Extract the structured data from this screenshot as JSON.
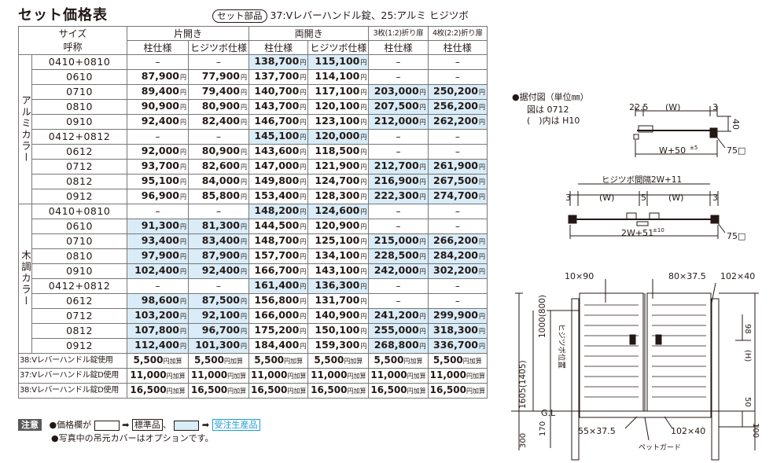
{
  "title": "セット価格表",
  "subtitle": {
    "badge": "セット部品",
    "text": "37:Vレバーハンドル錠、25:アルミ ヒジツボ"
  },
  "table": {
    "size_header": [
      "サイズ",
      "呼称"
    ],
    "group_headers": [
      "片開き",
      "両開き",
      "3枚(1:2)折り扉",
      "4枚(2:2)折り扉"
    ],
    "sub_headers": [
      "柱仕様",
      "ヒジツボ仕様",
      "柱仕様",
      "ヒジツボ仕様",
      "柱仕様",
      "柱仕様"
    ],
    "unit": "円",
    "groups": [
      {
        "name": "アルミカラー",
        "rows": [
          {
            "size": "0410+0810",
            "vals": [
              "–",
              "–",
              "138,700",
              "115,100",
              "–",
              "–"
            ],
            "blue": [
              false,
              false,
              true,
              true,
              false,
              false
            ]
          },
          {
            "size": "0610",
            "vals": [
              "87,900",
              "77,900",
              "137,700",
              "114,100",
              "–",
              "–"
            ],
            "blue": [
              false,
              false,
              false,
              false,
              false,
              false
            ]
          },
          {
            "size": "0710",
            "vals": [
              "89,400",
              "79,400",
              "140,700",
              "117,100",
              "203,000",
              "250,200"
            ],
            "blue": [
              false,
              false,
              false,
              false,
              true,
              true
            ]
          },
          {
            "size": "0810",
            "vals": [
              "90,900",
              "80,900",
              "143,700",
              "120,100",
              "207,500",
              "256,200"
            ],
            "blue": [
              false,
              false,
              false,
              false,
              true,
              true
            ]
          },
          {
            "size": "0910",
            "vals": [
              "92,400",
              "82,400",
              "146,700",
              "123,100",
              "212,000",
              "262,200"
            ],
            "blue": [
              false,
              false,
              false,
              false,
              true,
              true
            ]
          },
          {
            "size": "0412+0812",
            "vals": [
              "–",
              "–",
              "145,100",
              "120,000",
              "–",
              "–"
            ],
            "blue": [
              false,
              false,
              true,
              true,
              false,
              false
            ]
          },
          {
            "size": "0612",
            "vals": [
              "92,000",
              "80,900",
              "143,600",
              "118,500",
              "–",
              "–"
            ],
            "blue": [
              false,
              false,
              false,
              false,
              false,
              false
            ]
          },
          {
            "size": "0712",
            "vals": [
              "93,700",
              "82,600",
              "147,000",
              "121,900",
              "212,700",
              "261,900"
            ],
            "blue": [
              false,
              false,
              false,
              false,
              true,
              true
            ]
          },
          {
            "size": "0812",
            "vals": [
              "95,100",
              "84,000",
              "149,800",
              "124,700",
              "216,900",
              "267,500"
            ],
            "blue": [
              false,
              false,
              false,
              false,
              true,
              true
            ]
          },
          {
            "size": "0912",
            "vals": [
              "96,900",
              "85,800",
              "153,400",
              "128,300",
              "222,300",
              "274,700"
            ],
            "blue": [
              false,
              false,
              false,
              false,
              true,
              true
            ]
          }
        ]
      },
      {
        "name": "木調カラー",
        "rows": [
          {
            "size": "0410+0810",
            "vals": [
              "–",
              "–",
              "148,200",
              "124,600",
              "–",
              "–"
            ],
            "blue": [
              false,
              false,
              true,
              true,
              false,
              false
            ]
          },
          {
            "size": "0610",
            "vals": [
              "91,300",
              "81,300",
              "144,500",
              "120,900",
              "–",
              "–"
            ],
            "blue": [
              true,
              true,
              false,
              false,
              false,
              false
            ]
          },
          {
            "size": "0710",
            "vals": [
              "93,400",
              "83,400",
              "148,700",
              "125,100",
              "215,000",
              "266,200"
            ],
            "blue": [
              true,
              true,
              false,
              false,
              true,
              true
            ]
          },
          {
            "size": "0810",
            "vals": [
              "97,900",
              "87,900",
              "157,700",
              "134,100",
              "228,500",
              "284,200"
            ],
            "blue": [
              true,
              true,
              false,
              false,
              true,
              true
            ]
          },
          {
            "size": "0910",
            "vals": [
              "102,400",
              "92,400",
              "166,700",
              "143,100",
              "242,000",
              "302,200"
            ],
            "blue": [
              true,
              true,
              false,
              false,
              true,
              true
            ]
          },
          {
            "size": "0412+0812",
            "vals": [
              "–",
              "–",
              "161,400",
              "136,300",
              "–",
              "–"
            ],
            "blue": [
              false,
              false,
              true,
              true,
              false,
              false
            ]
          },
          {
            "size": "0612",
            "vals": [
              "98,600",
              "87,500",
              "156,800",
              "131,700",
              "–",
              "–"
            ],
            "blue": [
              true,
              true,
              false,
              false,
              false,
              false
            ]
          },
          {
            "size": "0712",
            "vals": [
              "103,200",
              "92,100",
              "166,000",
              "140,900",
              "241,200",
              "299,900"
            ],
            "blue": [
              true,
              true,
              false,
              false,
              true,
              true
            ]
          },
          {
            "size": "0812",
            "vals": [
              "107,800",
              "96,700",
              "175,200",
              "150,100",
              "255,000",
              "318,300"
            ],
            "blue": [
              true,
              true,
              false,
              false,
              true,
              true
            ]
          },
          {
            "size": "0912",
            "vals": [
              "112,400",
              "101,300",
              "184,400",
              "159,300",
              "268,800",
              "336,700"
            ],
            "blue": [
              true,
              true,
              false,
              false,
              true,
              true
            ]
          }
        ]
      }
    ],
    "add_unit": "円加算",
    "addons": [
      {
        "label": "38:Vレバーハンドル錠使用",
        "vals": [
          "5,500",
          "5,500",
          "5,500",
          "5,500",
          "5,500",
          "5,500"
        ]
      },
      {
        "label": "37:Vレバーハンドル錠D使用",
        "vals": [
          "11,000",
          "11,000",
          "11,000",
          "11,000",
          "11,000",
          "11,000"
        ]
      },
      {
        "label": "38:Vレバーハンドル錠D使用",
        "vals": [
          "16,500",
          "16,500",
          "16,500",
          "16,500",
          "16,500",
          "16,500"
        ]
      }
    ]
  },
  "notes": {
    "badge": "注意",
    "line1_prefix": "●価格欄が",
    "arrow": "➡",
    "standard": "標準品",
    "sep": "、",
    "custom": "受注生産品",
    "line2": "●写真中の吊元カバーはオプションです。"
  },
  "diagram": {
    "heading": "●据付図（単位㎜）",
    "note1": "図は 0712",
    "note2": "(　)内は H10",
    "top": {
      "l": "22.5",
      "w": "(W)",
      "r": "3",
      "h": "40",
      "total": "W+50",
      "tol": "±5",
      "post": "75□"
    },
    "mid": {
      "title": "ヒジツボ間隔2W+11",
      "l": "3",
      "w1": "(W)",
      "c": "5",
      "w2": "(W)",
      "r": "3",
      "total": "2W+51",
      "tol": "±10",
      "post": "75□"
    },
    "front": {
      "t1": "10×90",
      "t2": "80×37.5",
      "t3": "102×40",
      "h98": "98",
      "hH": "(H)",
      "hinge": "ヒジツボ位置",
      "h1000": "1000(800)",
      "h1605": "1605(1405)",
      "gl": "G.L",
      "h170": "170",
      "h300": "300",
      "h50": "50",
      "h100": "100",
      "b1": "55×37.5",
      "b2": "102×40",
      "guard": "ペットガード"
    }
  }
}
